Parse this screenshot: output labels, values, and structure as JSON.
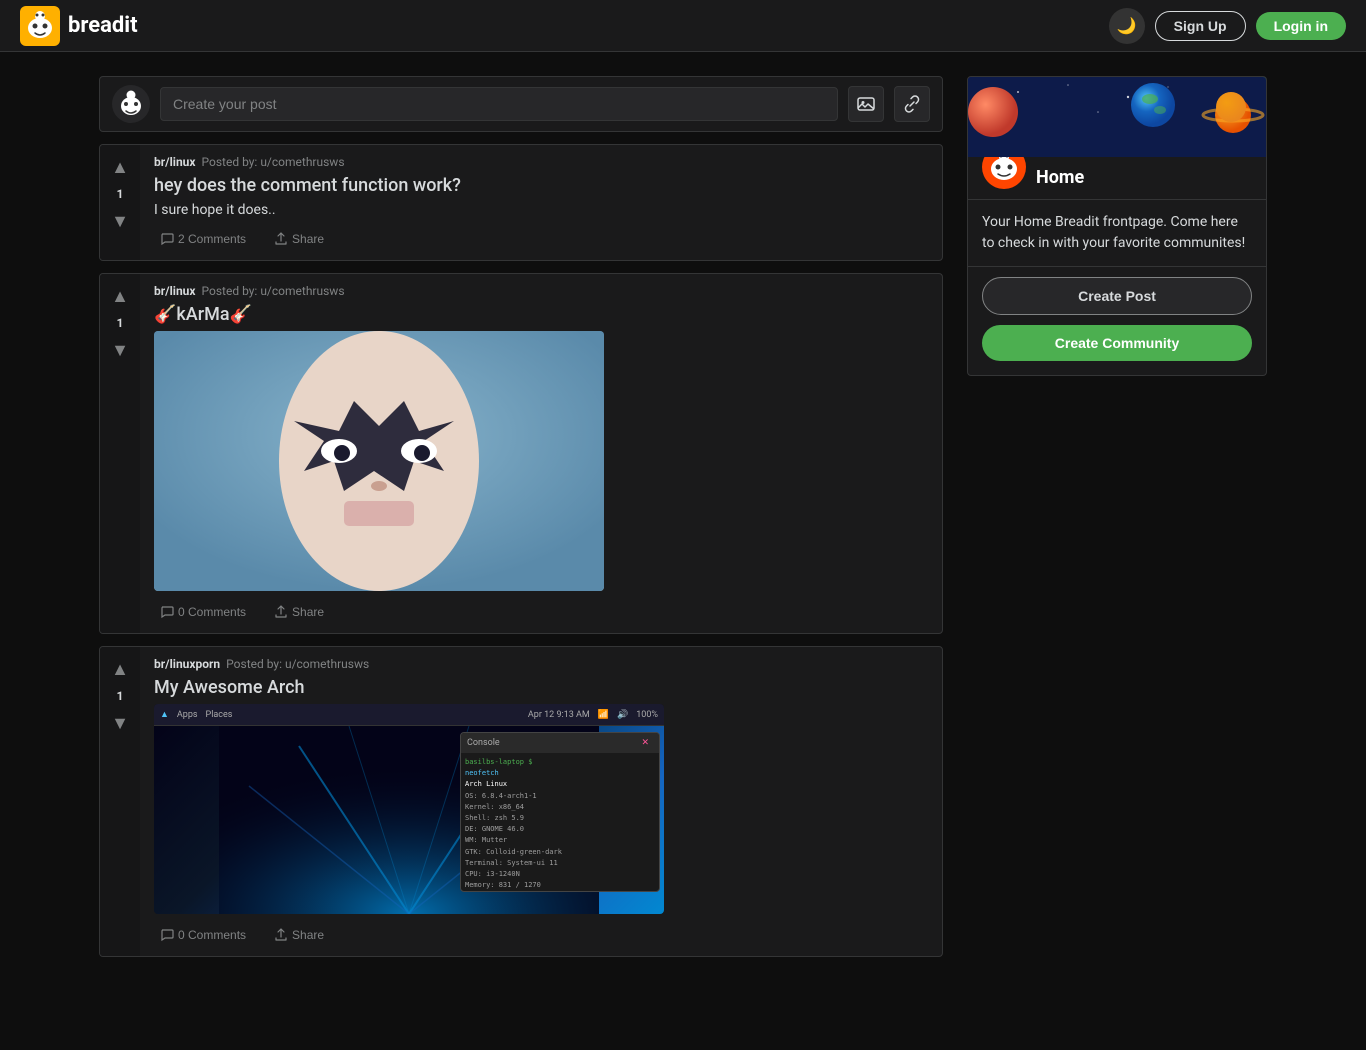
{
  "nav": {
    "logo_text": "breadit",
    "theme_icon": "🌙",
    "signup_label": "Sign Up",
    "login_label": "Login in"
  },
  "create_post": {
    "placeholder": "Create your post",
    "image_icon": "🖼",
    "link_icon": "🔗"
  },
  "posts": [
    {
      "id": "post1",
      "community": "br/linux",
      "author": "Posted by: u/comethrusws",
      "title": "hey does the comment function work?",
      "body": "I sure hope it does..",
      "votes": 1,
      "comments_count": "2 Comments",
      "share_label": "Share",
      "has_image": false
    },
    {
      "id": "post2",
      "community": "br/linux",
      "author": "Posted by: u/comethrusws",
      "title": "🎸kArMa🎸",
      "body": "",
      "votes": 1,
      "comments_count": "0 Comments",
      "share_label": "Share",
      "has_image": true,
      "image_type": "karma"
    },
    {
      "id": "post3",
      "community": "br/linuxporn",
      "author": "Posted by: u/comethrusws",
      "title": "My Awesome Arch",
      "body": "",
      "votes": 1,
      "comments_count": "0 Comments",
      "share_label": "Share",
      "has_image": true,
      "image_type": "arch"
    }
  ],
  "sidebar": {
    "title": "Home",
    "description": "Your Home Breadit frontpage. Come here to check in with your favorite communites!",
    "create_post_label": "Create Post",
    "create_community_label": "Create Community"
  },
  "icons": {
    "upvote": "▲",
    "downvote": "▼",
    "comment": "💬",
    "share": "⬆"
  }
}
